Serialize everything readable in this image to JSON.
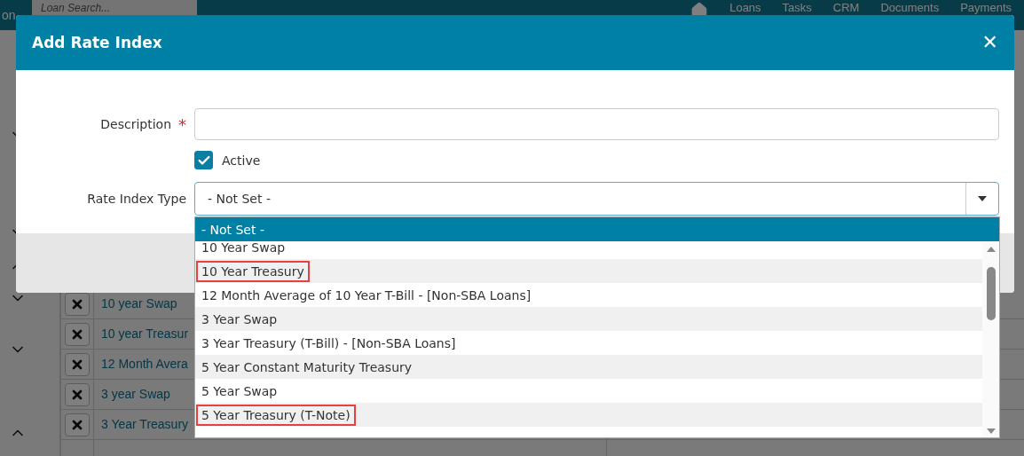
{
  "top_bar": {
    "brand_fragment": "on",
    "search": {
      "placeholder": "Loan Search..."
    },
    "nav": [
      "Loans",
      "Tasks",
      "CRM",
      "Documents",
      "Payments"
    ]
  },
  "background_table": {
    "rows": [
      {
        "name": "10 year Swap"
      },
      {
        "name": "10 year Treasur"
      },
      {
        "name": "12 Month Avera"
      },
      {
        "name": "3 year Swap"
      },
      {
        "name": "3 Year Treasury"
      }
    ]
  },
  "sidebar": {
    "sections": [
      {
        "expanded": false
      },
      {
        "expanded": false
      },
      {
        "expanded": true
      },
      {
        "expanded": false
      },
      {
        "expanded": false
      },
      {
        "expanded": true
      }
    ]
  },
  "dialog": {
    "title": "Add Rate Index",
    "close": "✕",
    "description": {
      "label": "Description",
      "required_mark": "*"
    },
    "active": {
      "label": "Active",
      "checked": true
    },
    "rate_index_type": {
      "label": "Rate Index Type",
      "value": "- Not Set -",
      "expanded": true,
      "options": [
        {
          "label": "- Not Set -",
          "selected": true,
          "highlighted": false
        },
        {
          "label": "10 Year Swap",
          "selected": false,
          "highlighted": false
        },
        {
          "label": "10 Year Treasury",
          "selected": false,
          "highlighted": true
        },
        {
          "label": "12 Month Average of 10 Year T-Bill - [Non-SBA Loans]",
          "selected": false,
          "highlighted": false
        },
        {
          "label": "3 Year Swap",
          "selected": false,
          "highlighted": false
        },
        {
          "label": "3 Year Treasury (T-Bill) - [Non-SBA Loans]",
          "selected": false,
          "highlighted": false
        },
        {
          "label": "5 Year Constant Maturity Treasury",
          "selected": false,
          "highlighted": false
        },
        {
          "label": "5 Year Swap",
          "selected": false,
          "highlighted": false
        },
        {
          "label": "5 Year Treasury (T-Note)",
          "selected": false,
          "highlighted": true
        }
      ]
    }
  }
}
